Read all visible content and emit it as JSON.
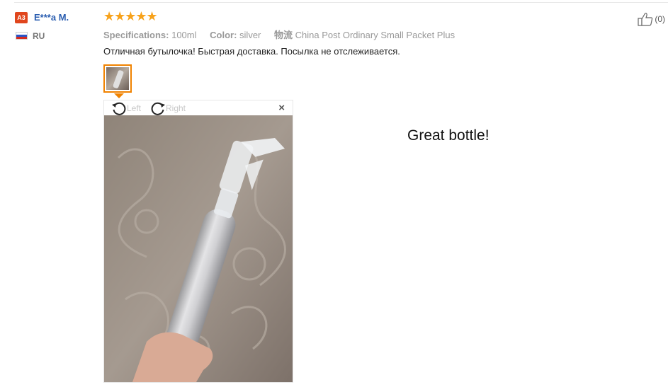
{
  "user": {
    "badge": "A3",
    "name": "E***a M.",
    "country": "RU",
    "flag_colors": [
      "#ffffff",
      "#2a55c6",
      "#d52b1e"
    ]
  },
  "review": {
    "stars": "★★★★★",
    "rating": 5,
    "star_color": "#f7a21b",
    "specs": {
      "spec_label": "Specifications:",
      "spec_value": "100ml",
      "color_label": "Color:",
      "color_value": "silver",
      "logistics_label": "物流",
      "logistics_value": "China Post Ordinary Small Packet Plus"
    },
    "text": "Отличная бутылочка! Быстрая доставка. Посылка не отслеживается."
  },
  "helpful": {
    "icon": "thumbs-up-icon",
    "count": "(0)"
  },
  "viewer": {
    "rotate_left": "Left",
    "rotate_right": "Right",
    "close": "×"
  },
  "caption": "Great bottle!"
}
